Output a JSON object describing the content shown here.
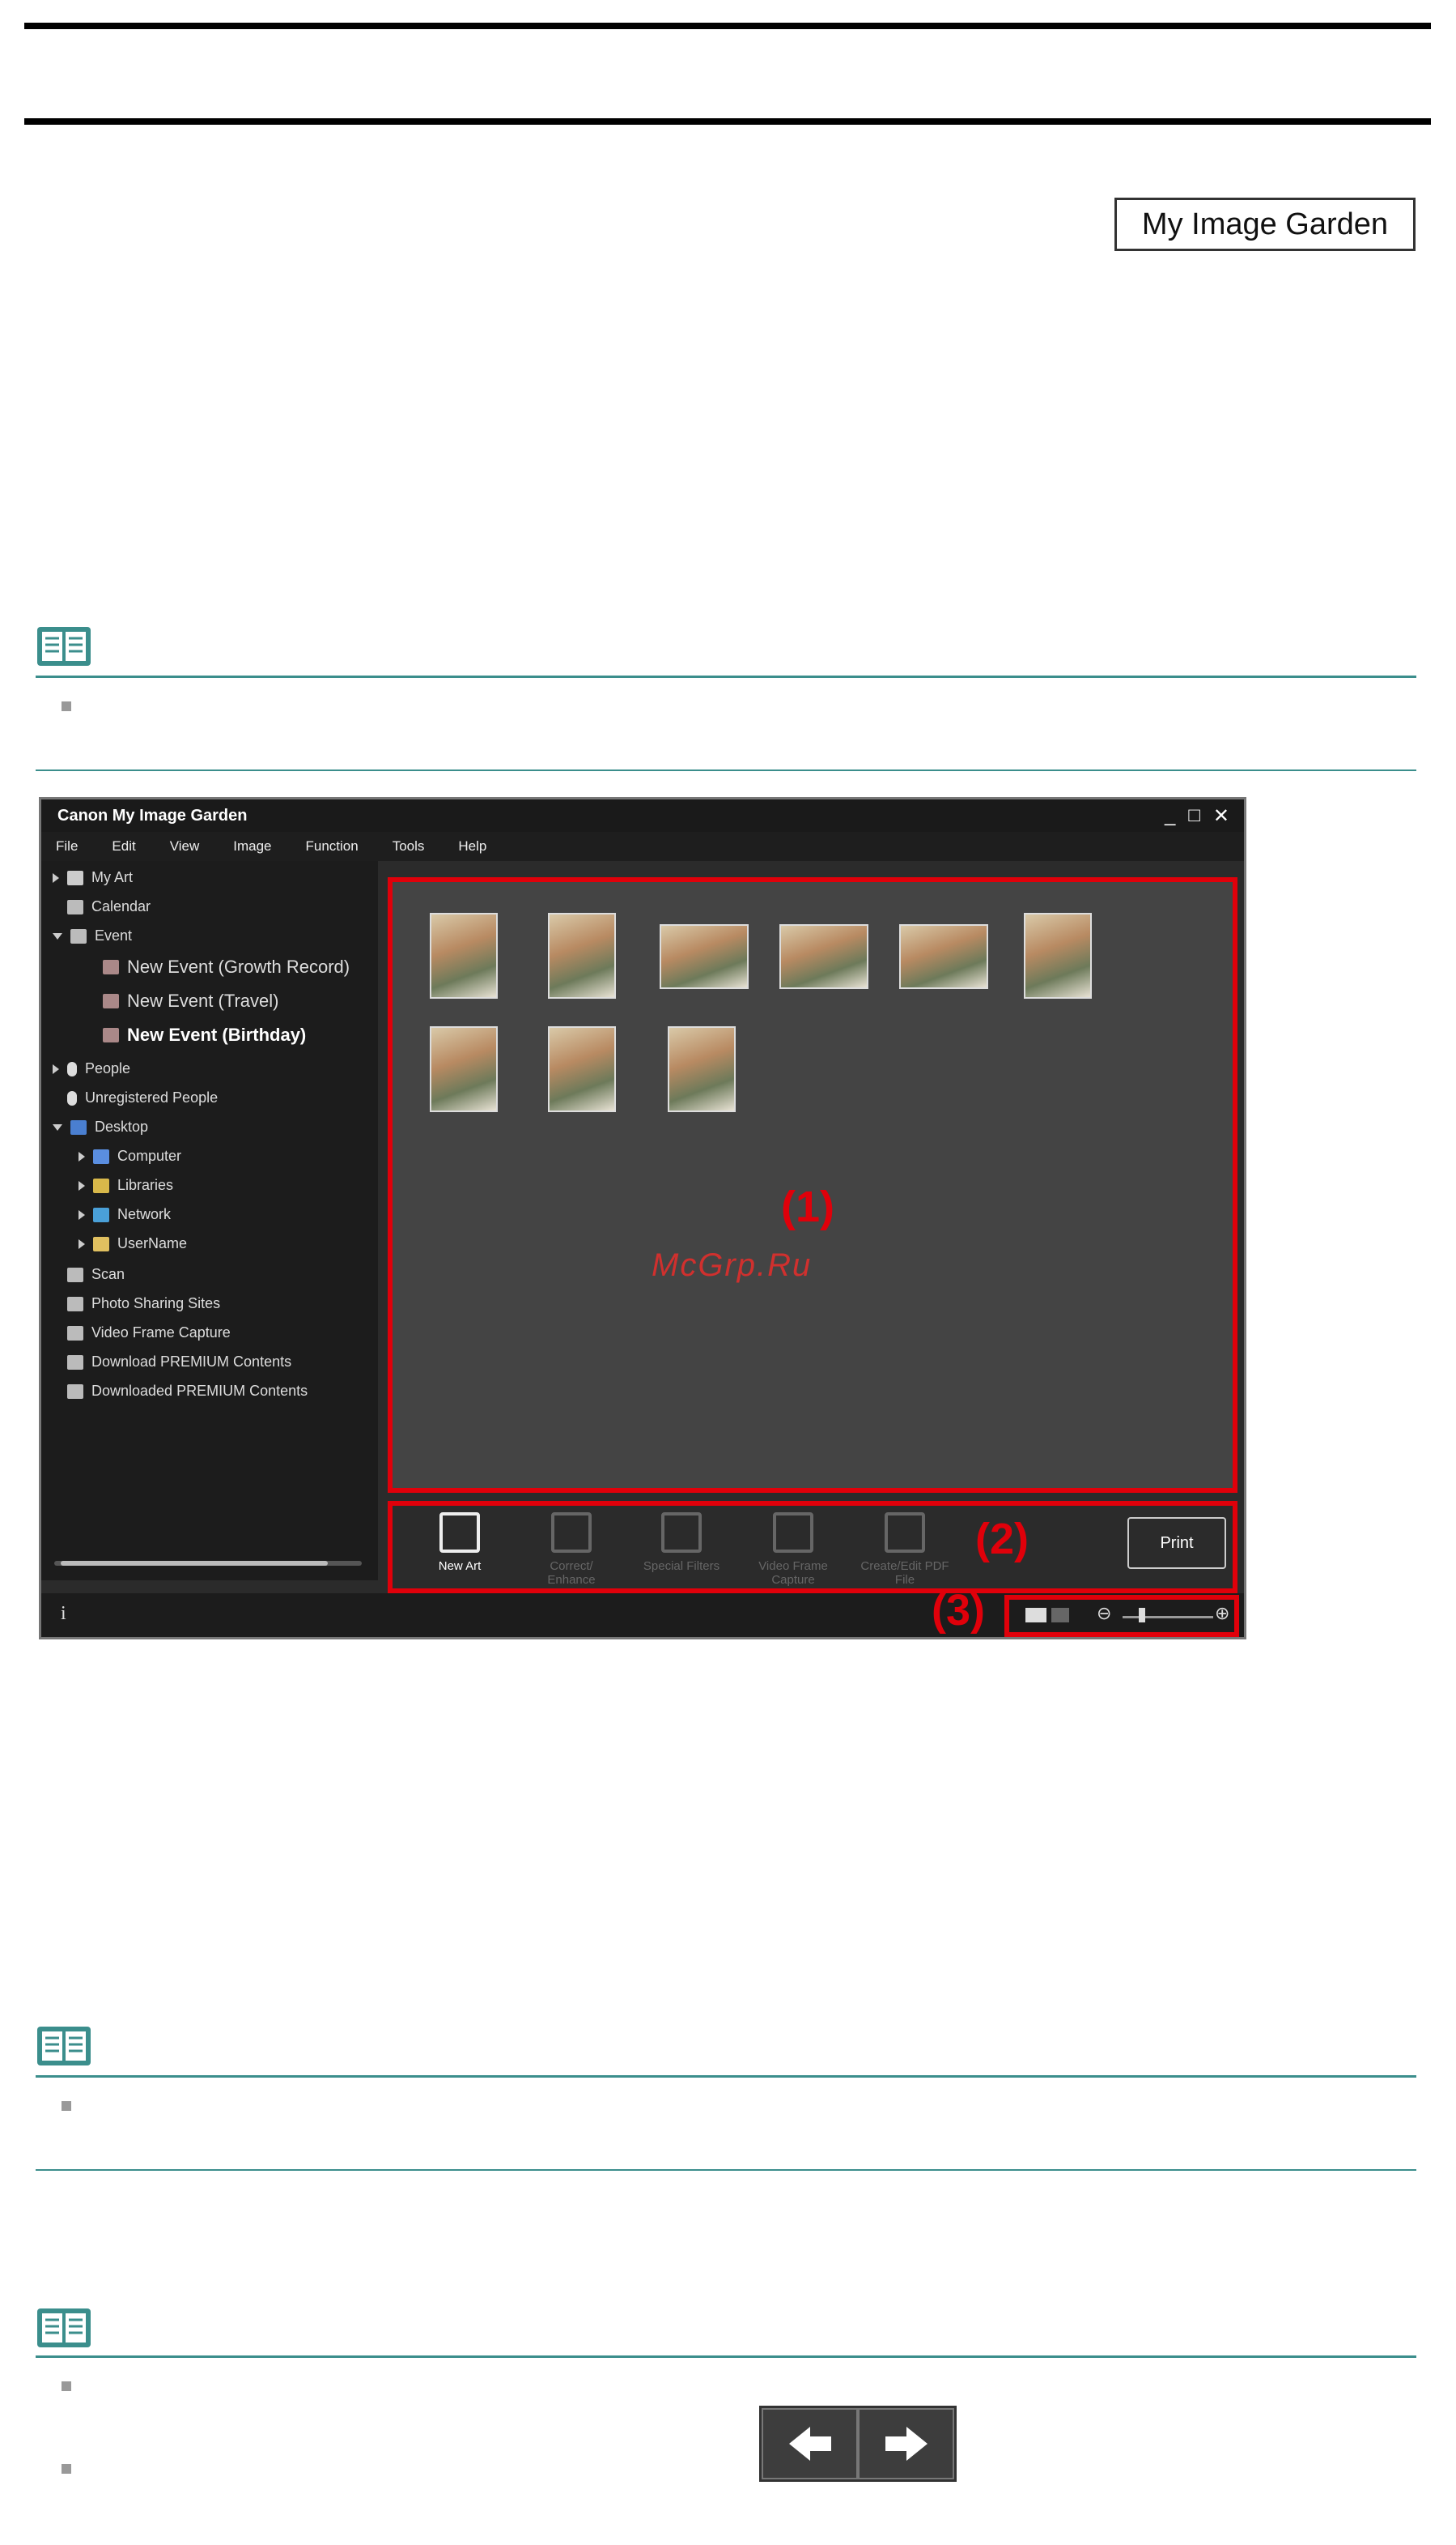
{
  "header": {
    "tag_label": "My Image Garden"
  },
  "app": {
    "title": "Canon My Image Garden",
    "menu": [
      "File",
      "Edit",
      "View",
      "Image",
      "Function",
      "Tools",
      "Help"
    ],
    "sidebar": {
      "items": [
        {
          "label": "My Art"
        },
        {
          "label": "Calendar"
        },
        {
          "label": "Event"
        },
        {
          "label": "New Event (Growth Record)"
        },
        {
          "label": "New Event (Travel)"
        },
        {
          "label": "New Event (Birthday)"
        },
        {
          "label": "People"
        },
        {
          "label": "Unregistered People"
        },
        {
          "label": "Desktop"
        },
        {
          "label": "Computer"
        },
        {
          "label": "Libraries"
        },
        {
          "label": "Network"
        },
        {
          "label": "UserName"
        },
        {
          "label": "Scan"
        },
        {
          "label": "Photo Sharing Sites"
        },
        {
          "label": "Video Frame Capture"
        },
        {
          "label": "Download PREMIUM Contents"
        },
        {
          "label": "Downloaded PREMIUM Contents"
        }
      ]
    },
    "area_labels": {
      "content": "(1)",
      "toolbar": "(2)",
      "zoom": "(3)"
    },
    "toolbar": {
      "new_art": "New Art",
      "correct": "Correct/ Enhance",
      "special": "Special Filters",
      "video": "Video Frame Capture",
      "pdf": "Create/Edit PDF File",
      "print": "Print"
    },
    "status": {
      "info": "i",
      "zoom_minus": "⊖",
      "zoom_plus": "⊕"
    }
  },
  "watermark": "McGrp.Ru",
  "colors": {
    "highlight": "#e0000a",
    "note_rule": "#3b8e8c"
  }
}
